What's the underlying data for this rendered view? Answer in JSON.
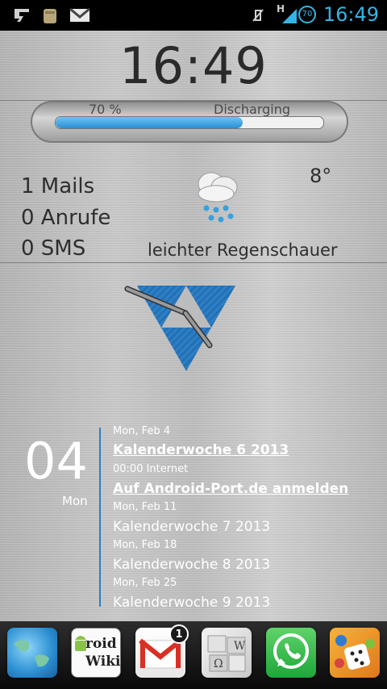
{
  "statusbar": {
    "time": "16:49",
    "battery_level": "70",
    "network": "H",
    "accent": "#33b5e5"
  },
  "clock": {
    "time": "16:49"
  },
  "battery_widget": {
    "percent_label": "70 %",
    "state": "Discharging",
    "level": 0.7
  },
  "stats": {
    "mails": "1 Mails",
    "calls": "0 Anrufe",
    "sms": "0 SMS"
  },
  "weather": {
    "temp": "8°",
    "desc": "leichter Regenschauer",
    "icon": "cloud-rain-icon"
  },
  "calendar": {
    "day_number": "04",
    "weekday": "Mon",
    "accent": "#2d7fc0",
    "events": [
      {
        "date": "Mon, Feb 4",
        "title": "Kalenderwoche 6 2013",
        "underlined": true
      },
      {
        "date": "00:00   Internet",
        "title": "Auf Android-Port.de anmelden",
        "underlined": true
      },
      {
        "date": "Mon, Feb 11",
        "title": "Kalenderwoche 7 2013",
        "underlined": false
      },
      {
        "date": "Mon, Feb 18",
        "title": "Kalenderwoche 8 2013",
        "underlined": false
      },
      {
        "date": "Mon, Feb 25",
        "title": "Kalenderwoche 9 2013",
        "underlined": false
      }
    ]
  },
  "dock": {
    "apps": [
      {
        "name": "Maps",
        "icon": "globe-icon"
      },
      {
        "name": "DroidWiki",
        "icon": "droidwiki-icon",
        "label_top": "roid",
        "label_bottom": "Wiki"
      },
      {
        "name": "Gmail",
        "icon": "gmail-icon",
        "badge": "1"
      },
      {
        "name": "Wikipedia",
        "icon": "wikipedia-icon"
      },
      {
        "name": "WhatsApp",
        "icon": "whatsapp-icon"
      },
      {
        "name": "Games",
        "icon": "game-dice-icon"
      }
    ]
  }
}
